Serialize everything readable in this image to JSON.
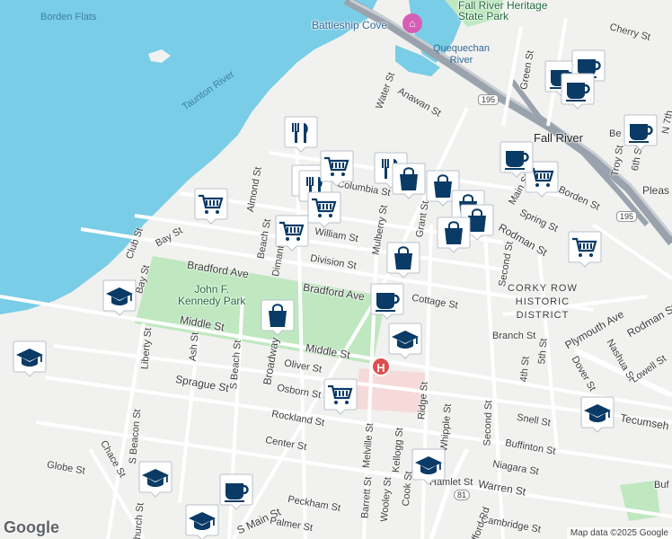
{
  "labels": {
    "borden_flats": "Borden Flats",
    "taunton_river": "Taunton River",
    "battleship_cove": "Battleship Cove",
    "fall_river_heritage": "Fall River Heritage\nState Park",
    "quequechan_river": "Quequechan\nRiver",
    "fall_river": "Fall River",
    "corky_row": "CORKY ROW\nHISTORIC\nDISTRICT",
    "jfk_park": "John F.\nKennedy Park"
  },
  "streets": {
    "water_st": "Water St",
    "anawan_st": "Anawan St",
    "green_st": "Green St",
    "cherry_st": "Cherry St",
    "columbia_st": "Columbia St",
    "almond_st": "Almond St",
    "beach_st": "Beach St",
    "dimant_st": "Dimant St",
    "william_st": "William St",
    "mulberry_st": "Mulberry St",
    "grant_st": "Grant St",
    "division_st": "Division St",
    "bradford_ave_w": "Bradford Ave",
    "bradford_ave_e": "Bradford Ave",
    "cottage_st": "Cottage St",
    "club_st": "Club St",
    "bay_st": "Bay St",
    "bay_st_2": "Bay St",
    "middle_st_w": "Middle St",
    "middle_st_e": "Middle St",
    "broadway": "Broadway",
    "liberty_st": "Liberty St",
    "ash_st": "Ash St",
    "s_beach_st": "S Beach St",
    "oliver_st": "Oliver St",
    "osborn_st": "Osborn St",
    "sprague_st": "Sprague St",
    "rockland_st": "Rockland St",
    "center_st": "Center St",
    "s_beacon_st": "S Beacon St",
    "chace_st": "Chace St",
    "globe_st": "Globe St",
    "church_st": "Church St",
    "s_main_st": "S Main St",
    "peckham_st": "Peckham St",
    "palmer_st": "Palmer St",
    "melville_st": "Melville St",
    "barrett_st": "Barrett St",
    "wooley_st": "Wooley St",
    "kellogg_st": "Kellogg St",
    "cook_st": "Cook St",
    "ridge_st": "Ridge St",
    "whipple_st": "Whipple St",
    "second_st_s": "Second St",
    "second_st_n": "Second St",
    "hamlet_st": "Hamlet St",
    "warren_st": "Warren St",
    "stafford_rd": "Stafford Rd",
    "cambridge_st": "Cambridge St",
    "niagara_st": "Niagara St",
    "buffinton_st": "Buffinton St",
    "snell_st": "Snell St",
    "tecumseh_st": "Tecumseh St",
    "branch_st": "Branch St",
    "fourth_st": "4th St",
    "fifth_st": "5th St",
    "dover_st": "Dover St",
    "nashua_st": "Nashua St",
    "lowell_st": "Lowell St",
    "plymouth_ave": "Plymouth Ave",
    "rodman_st_e": "Rodman St",
    "rodman_st_w": "Rodman St",
    "spring_st": "Spring St",
    "borden_st": "Borden St",
    "pleasant_st": "Pleas",
    "troy_st": "Troy St",
    "sixth_st": "6th St",
    "seventh_st": "N 7th",
    "bedford_st": "Be",
    "main_st": "Main St",
    "buf": "Buf"
  },
  "shields": {
    "i195_a": "195",
    "i195_b": "195",
    "r81": "81"
  },
  "footer": {
    "logo": "Google",
    "attribution": "Map data ©2025 Google"
  },
  "markers": [
    {
      "type": "restaurant",
      "icon": "restaurant-icon"
    },
    {
      "type": "restaurant",
      "icon": "restaurant-icon"
    },
    {
      "type": "restaurant",
      "icon": "restaurant-icon"
    },
    {
      "type": "restaurant",
      "icon": "restaurant-icon"
    },
    {
      "type": "grocery",
      "icon": "shopping-cart-icon"
    },
    {
      "type": "grocery",
      "icon": "shopping-cart-icon"
    },
    {
      "type": "grocery",
      "icon": "shopping-cart-icon"
    },
    {
      "type": "grocery",
      "icon": "shopping-cart-icon"
    },
    {
      "type": "grocery",
      "icon": "shopping-cart-icon"
    },
    {
      "type": "grocery",
      "icon": "shopping-cart-icon"
    },
    {
      "type": "grocery",
      "icon": "shopping-cart-icon"
    },
    {
      "type": "shopping",
      "icon": "shopping-bag-icon"
    },
    {
      "type": "shopping",
      "icon": "shopping-bag-icon"
    },
    {
      "type": "shopping",
      "icon": "shopping-bag-icon"
    },
    {
      "type": "shopping",
      "icon": "shopping-bag-icon"
    },
    {
      "type": "shopping",
      "icon": "shopping-bag-icon"
    },
    {
      "type": "shopping",
      "icon": "shopping-bag-icon"
    },
    {
      "type": "shopping",
      "icon": "shopping-bag-icon"
    },
    {
      "type": "cafe",
      "icon": "coffee-cup-icon"
    },
    {
      "type": "cafe",
      "icon": "coffee-cup-icon"
    },
    {
      "type": "cafe",
      "icon": "coffee-cup-icon"
    },
    {
      "type": "cafe",
      "icon": "coffee-cup-icon"
    },
    {
      "type": "cafe",
      "icon": "coffee-cup-icon"
    },
    {
      "type": "cafe",
      "icon": "coffee-cup-icon"
    },
    {
      "type": "cafe",
      "icon": "coffee-cup-icon"
    },
    {
      "type": "school",
      "icon": "graduation-cap-icon"
    },
    {
      "type": "school",
      "icon": "graduation-cap-icon"
    },
    {
      "type": "school",
      "icon": "graduation-cap-icon"
    },
    {
      "type": "school",
      "icon": "graduation-cap-icon"
    },
    {
      "type": "school",
      "icon": "graduation-cap-icon"
    },
    {
      "type": "school",
      "icon": "graduation-cap-icon"
    },
    {
      "type": "school",
      "icon": "graduation-cap-icon"
    },
    {
      "type": "school",
      "icon": "graduation-cap-icon"
    }
  ],
  "colors": {
    "water": "#79cde6",
    "land": "#f1f1ef",
    "park": "#bfe8c0",
    "road": "#ffffff",
    "highway": "#9aa3ad",
    "marker_fill": "#ffffff",
    "marker_icon": "#0a3a66",
    "hospital": "#e04e4e"
  }
}
